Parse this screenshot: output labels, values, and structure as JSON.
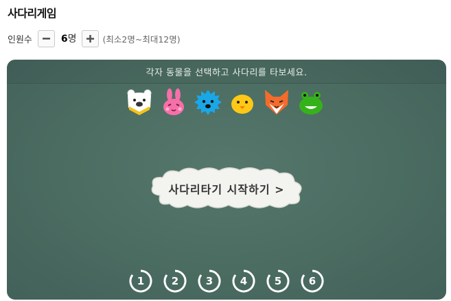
{
  "title": "사다리게임",
  "participants": {
    "label": "인원수",
    "count": 6,
    "unit": "명",
    "range": "(최소2명~최대12명)"
  },
  "board": {
    "instruction": "각자 동물을 선택하고 사다리를 타보세요.",
    "start_button": "사다리타기 시작하기 >",
    "animals": [
      "bear-icon",
      "rabbit-icon",
      "hedgehog-icon",
      "chick-icon",
      "fox-icon",
      "frog-icon"
    ],
    "numbers": [
      "1",
      "2",
      "3",
      "4",
      "5",
      "6"
    ]
  },
  "colors": {
    "board": "#4b6c61",
    "cloud": "#f3f3f0"
  }
}
